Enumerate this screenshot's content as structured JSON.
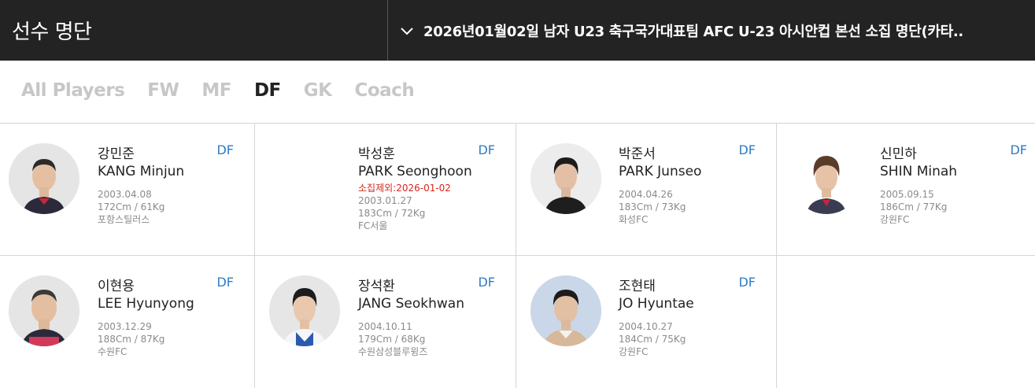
{
  "header": {
    "title": "선수 명단",
    "roster_select": "2026년01월02일 남자 U23 축구국가대표팀 AFC U-23 아시안컵 본선 소집 명단(카타.."
  },
  "tabs": [
    "All Players",
    "FW",
    "MF",
    "DF",
    "GK",
    "Coach"
  ],
  "active_tab": "DF",
  "colors": {
    "position": "#2f7cc1",
    "excluded": "#d9251c",
    "header_bg": "#232323"
  },
  "players": [
    {
      "name_kr": "강민준",
      "name_en": "KANG Minjun",
      "position": "DF",
      "excluded": "",
      "birth": "2003.04.08",
      "body": "172Cm / 61Kg",
      "club": "포항스틸러스"
    },
    {
      "name_kr": "박성훈",
      "name_en": "PARK Seonghoon",
      "position": "DF",
      "excluded": "소집제외:2026-01-02",
      "birth": "2003.01.27",
      "body": "183Cm / 72Kg",
      "club": "FC서울"
    },
    {
      "name_kr": "박준서",
      "name_en": "PARK Junseo",
      "position": "DF",
      "excluded": "",
      "birth": "2004.04.26",
      "body": "183Cm / 73Kg",
      "club": "화성FC"
    },
    {
      "name_kr": "신민하",
      "name_en": "SHIN Minah",
      "position": "DF",
      "excluded": "",
      "birth": "2005.09.15",
      "body": "186Cm / 77Kg",
      "club": "강원FC"
    },
    {
      "name_kr": "이현용",
      "name_en": "LEE Hyunyong",
      "position": "DF",
      "excluded": "",
      "birth": "2003.12.29",
      "body": "188Cm / 87Kg",
      "club": "수원FC"
    },
    {
      "name_kr": "장석환",
      "name_en": "JANG Seokhwan",
      "position": "DF",
      "excluded": "",
      "birth": "2004.10.11",
      "body": "179Cm / 68Kg",
      "club": "수원삼성블루윙즈"
    },
    {
      "name_kr": "조현태",
      "name_en": "JO Hyuntae",
      "position": "DF",
      "excluded": "",
      "birth": "2004.10.27",
      "body": "184Cm / 75Kg",
      "club": "강원FC"
    }
  ]
}
